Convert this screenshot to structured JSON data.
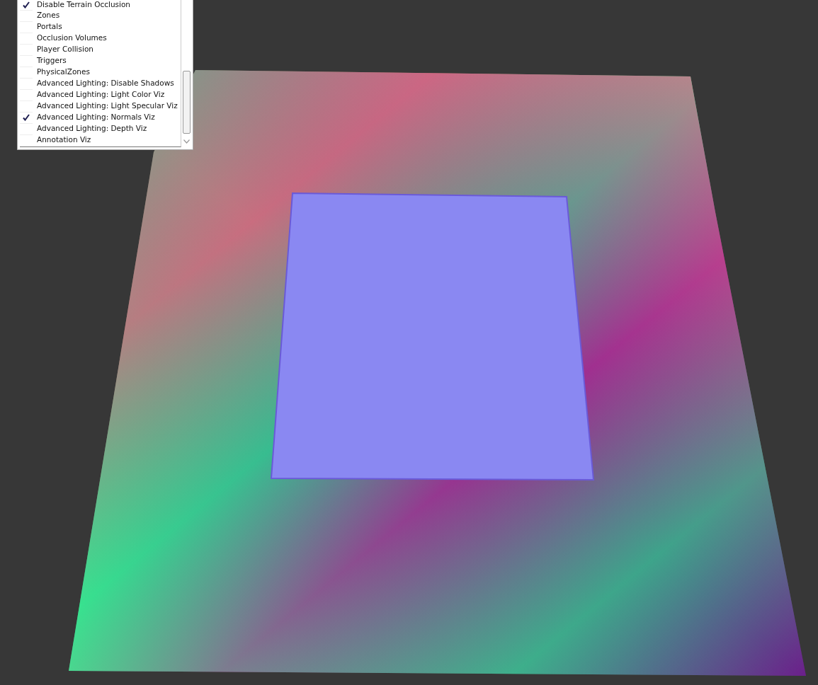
{
  "menu": {
    "items": [
      {
        "label": "Disable Terrain Occlusion",
        "checked": true
      },
      {
        "label": "Zones",
        "checked": false
      },
      {
        "label": "Portals",
        "checked": false
      },
      {
        "label": "Occlusion Volumes",
        "checked": false
      },
      {
        "label": "Player Collision",
        "checked": false
      },
      {
        "label": "Triggers",
        "checked": false
      },
      {
        "label": "PhysicalZones",
        "checked": false
      },
      {
        "label": "Advanced Lighting: Disable Shadows",
        "checked": false
      },
      {
        "label": "Advanced Lighting: Light Color Viz",
        "checked": false
      },
      {
        "label": "Advanced Lighting: Light Specular Viz",
        "checked": false
      },
      {
        "label": "Advanced Lighting: Normals Viz",
        "checked": true
      },
      {
        "label": "Advanced Lighting: Depth Viz",
        "checked": false
      },
      {
        "label": "Annotation Viz",
        "checked": false
      }
    ]
  }
}
